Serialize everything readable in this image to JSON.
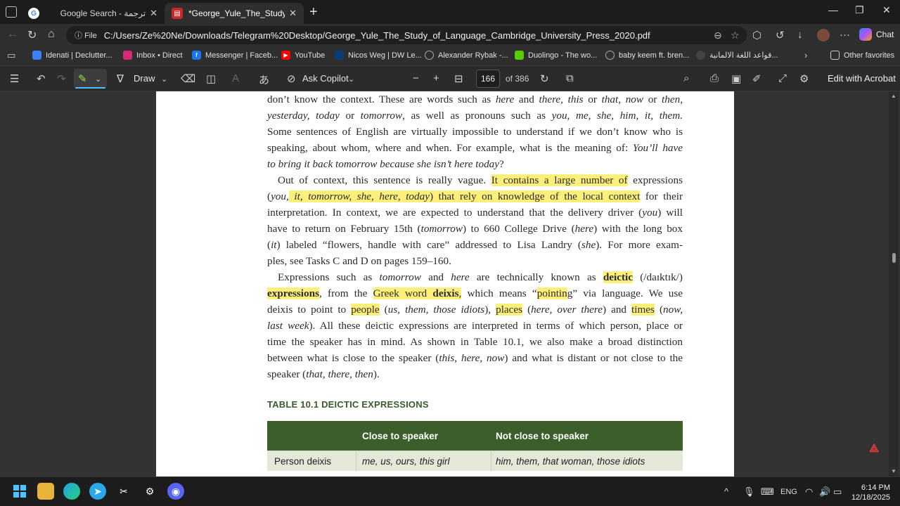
{
  "tabs": [
    {
      "title": "Google Search - ترجمة",
      "icon": "google-icon"
    },
    {
      "title": "*George_Yule_The_Study_of_Langu",
      "icon": "pdf-icon"
    }
  ],
  "address": {
    "info": "File",
    "url": "C:/Users/Ze%20Ne/Downloads/Telegram%20Desktop/George_Yule_The_Study_of_Language_Cambridge_University_Press_2020.pdf"
  },
  "copilot_label": "Chat",
  "favorites": [
    {
      "label": "Idenati | Declutter...",
      "color": "#3b82f6"
    },
    {
      "label": "Inbox • Direct",
      "color": "#d62976"
    },
    {
      "label": "Messenger | Faceb...",
      "color": "#1877f2"
    },
    {
      "label": "YouTube",
      "color": "#ff0000"
    },
    {
      "label": "Nicos Weg | DW Le...",
      "color": "#0b3c7a"
    },
    {
      "label": "Alexander Rybak -...",
      "color": "#666666"
    },
    {
      "label": "Duolingo - The wo...",
      "color": "#58cc02"
    },
    {
      "label": "baby keem ft. bren...",
      "color": "#666666"
    },
    {
      "label": "قواعد اللغة الالمانية...",
      "color": "#444444"
    }
  ],
  "other_favorites": "Other favorites",
  "pdf_toolbar": {
    "draw": "Draw",
    "ask_copilot": "Ask Copilot",
    "page": "166",
    "of": "of 386",
    "edit": "Edit with Acrobat"
  },
  "text": {
    "l1": {
      "a": "don’t know the context. These are words such as ",
      "b": "here",
      "c": " and ",
      "d": "there, this",
      "e": " or ",
      "f": "that, now",
      "g": " or ",
      "h": "then,"
    },
    "l2": {
      "a": "yesterday, today",
      "b": " or ",
      "c": "tomorrow",
      "d": ", as well as pronouns such as ",
      "e": "you, me, she, him, it, them."
    },
    "l3": "Some sentences of English are virtually impossible to understand if we don’t know who is",
    "l4": {
      "a": "speaking, about whom, where and when. For example, what is the meaning of: ",
      "b": "You’ll have"
    },
    "l5": {
      "a": "to bring it back tomorrow because she isn’t here today",
      "b": "?"
    },
    "l6": {
      "a": "Out of context, this sentence is really vague. ",
      "b": "It contains a large number of",
      "c": " expressions"
    },
    "l7": {
      "a": "(",
      "b": "you,",
      "c": " it, tomorrow, she, here, today",
      "d": ") that rely on knowledge of the local context",
      "e": " for their"
    },
    "l8": {
      "a": "interpretation. In context, we are expected to understand that the delivery driver (",
      "b": "you",
      "c": ") will"
    },
    "l9": {
      "a": "have to return on February 15th (",
      "b": "tomorrow",
      "c": ") to 660 College Drive (",
      "d": "here",
      "e": ") with the long box"
    },
    "l10": {
      "a": "(",
      "b": "it",
      "c": ") labeled “flowers, handle with care” addressed to Lisa Landry (",
      "d": "she",
      "e": "). For more exam-"
    },
    "l11": "ples, see Tasks C and D on pages 159–160.",
    "l12": {
      "a": "Expressions such as ",
      "b": "tomorrow",
      "c": " and ",
      "d": "here",
      "e": " are technically known as ",
      "f": "deictic",
      "g": " (/daɪktɪk/)"
    },
    "l13": {
      "a": "expressions",
      "b": ", from the ",
      "c": "Greek word ",
      "d": "deixis",
      "e": ",",
      "f": " which means “",
      "g": "pointin",
      "h": "g” via language. We use"
    },
    "l14": {
      "a": "deixis to point to ",
      "b": "people",
      "c": " (",
      "d": "us, them, those idiots",
      "e": "), ",
      "f": "places",
      "g": " (",
      "h": "here, over there",
      "i": ") and ",
      "j": "times",
      "k": " (",
      "l": "now,"
    },
    "l15": {
      "a": "last week",
      "b": "). All these deictic expressions are interpreted in terms of which person, place or"
    },
    "l16": "time the speaker has in mind. As shown in Table 10.1, we also make a broad distinction",
    "l17": {
      "a": "between what is close to the speaker (",
      "b": "this, here, now",
      "c": ") and what is distant or not close to the"
    },
    "l18": {
      "a": "speaker (",
      "b": "that, there, then",
      "c": ")."
    }
  },
  "table": {
    "caption": "TABLE 10.1  DEICTIC EXPRESSIONS",
    "headers": [
      "",
      "Close to speaker",
      "Not close to speaker"
    ],
    "rows": [
      [
        "Person deixis",
        "me, us, ours, this girl",
        "him, them, that woman, those idiots"
      ]
    ]
  },
  "taskbar": {
    "lang": "ENG",
    "time": "6:14 PM",
    "date": "12/18/2025"
  }
}
